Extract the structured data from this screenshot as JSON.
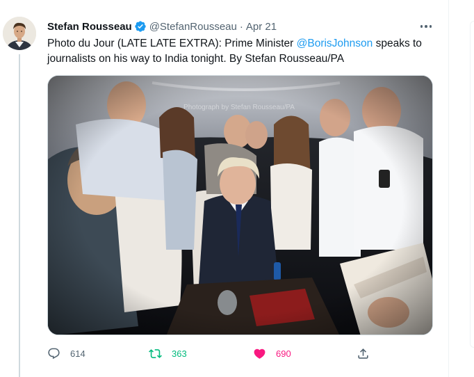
{
  "tweet": {
    "author": {
      "name": "Stefan Rousseau",
      "handle": "@StefanRousseau",
      "verified": true
    },
    "separator": "·",
    "date": "Apr 21",
    "text": {
      "before": "Photo du Jour (LATE LATE EXTRA): Prime Minister ",
      "mention": "@BorisJohnson",
      "after": " speaks to journalists on his way to India tonight. By Stefan Rousseau/PA"
    },
    "media": {
      "watermark": "Photograph by Stefan Rousseau/PA"
    },
    "actions": {
      "replies": "614",
      "retweets": "363",
      "likes": "690"
    }
  },
  "colors": {
    "accent": "#1d9bf0",
    "retweet": "#00ba7c",
    "like": "#f91880",
    "muted": "#536471"
  },
  "icons": {
    "verified": "verified-badge-icon",
    "more": "more-dots-icon",
    "reply": "reply-bubble-icon",
    "retweet": "retweet-arrows-icon",
    "like": "heart-filled-icon",
    "share": "share-upload-icon"
  }
}
